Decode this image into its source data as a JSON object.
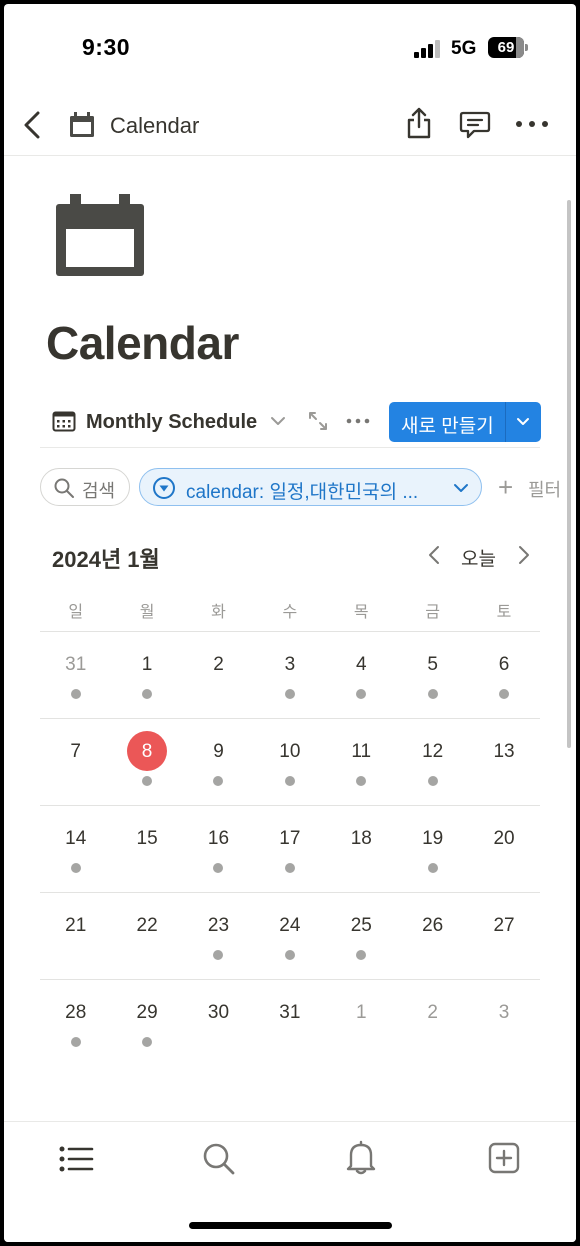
{
  "status_bar": {
    "time": "9:30",
    "network": "5G",
    "battery": "69"
  },
  "navbar": {
    "title": "Calendar",
    "icons": [
      "back-icon",
      "calendar-icon",
      "share-icon",
      "comment-icon",
      "more-icon"
    ]
  },
  "page": {
    "title": "Calendar",
    "icon": "calendar-icon"
  },
  "view": {
    "name": "Monthly Schedule",
    "new_button": "새로 만들기",
    "icons": [
      "calendar-view-icon",
      "chevron-down-icon",
      "expand-icon",
      "more-icon"
    ]
  },
  "filters": {
    "search_label": "검색",
    "active_filter": "calendar: 일정,대한민국의 ...",
    "add_filter": "필터"
  },
  "calendar": {
    "month": "2024년 1월",
    "today_label": "오늘",
    "weekdays": [
      "일",
      "월",
      "화",
      "수",
      "목",
      "금",
      "토"
    ],
    "weeks": [
      [
        {
          "d": "31",
          "muted": true,
          "dot": true
        },
        {
          "d": "1",
          "dot": true
        },
        {
          "d": "2",
          "dot": false
        },
        {
          "d": "3",
          "dot": true
        },
        {
          "d": "4",
          "dot": true
        },
        {
          "d": "5",
          "dot": true
        },
        {
          "d": "6",
          "dot": true
        }
      ],
      [
        {
          "d": "7",
          "dot": false
        },
        {
          "d": "8",
          "today": true,
          "dot": true
        },
        {
          "d": "9",
          "dot": true
        },
        {
          "d": "10",
          "dot": true
        },
        {
          "d": "11",
          "dot": true
        },
        {
          "d": "12",
          "dot": true
        },
        {
          "d": "13",
          "dot": false
        }
      ],
      [
        {
          "d": "14",
          "dot": true
        },
        {
          "d": "15",
          "dot": false
        },
        {
          "d": "16",
          "dot": true
        },
        {
          "d": "17",
          "dot": true
        },
        {
          "d": "18",
          "dot": false
        },
        {
          "d": "19",
          "dot": true
        },
        {
          "d": "20",
          "dot": false
        }
      ],
      [
        {
          "d": "21",
          "dot": false
        },
        {
          "d": "22",
          "dot": false
        },
        {
          "d": "23",
          "dot": true
        },
        {
          "d": "24",
          "dot": true
        },
        {
          "d": "25",
          "dot": true
        },
        {
          "d": "26",
          "dot": false
        },
        {
          "d": "27",
          "dot": false
        }
      ],
      [
        {
          "d": "28",
          "dot": true
        },
        {
          "d": "29",
          "dot": true
        },
        {
          "d": "30",
          "dot": false
        },
        {
          "d": "31",
          "dot": false
        },
        {
          "d": "1",
          "muted": true,
          "dot": false
        },
        {
          "d": "2",
          "muted": true,
          "dot": false
        },
        {
          "d": "3",
          "muted": true,
          "dot": false
        }
      ]
    ]
  },
  "tabbar": {
    "icons": [
      "home-list-icon",
      "search-icon",
      "bell-icon",
      "new-page-icon"
    ]
  },
  "colors": {
    "accent": "#2383e2",
    "today": "#eb5757",
    "dot": "#a5a5a3",
    "text": "#37352f"
  }
}
